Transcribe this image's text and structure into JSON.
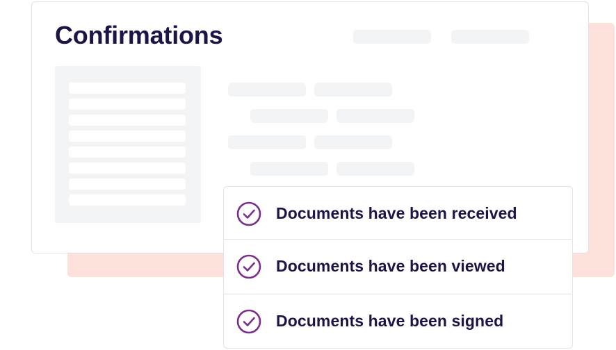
{
  "header": {
    "title": "Confirmations"
  },
  "status_list": {
    "items": [
      {
        "label": "Documents have been received",
        "icon": "check-circle-icon",
        "state": "done"
      },
      {
        "label": "Documents have been viewed",
        "icon": "check-circle-icon",
        "state": "done"
      },
      {
        "label": "Documents have been signed",
        "icon": "check-circle-icon",
        "state": "done"
      }
    ]
  },
  "colors": {
    "title_text": "#1c1446",
    "check_accent": "#7b2d8e",
    "backdrop": "#fbe1da",
    "placeholder": "#f3f4f6",
    "border": "#e3e3e8"
  }
}
